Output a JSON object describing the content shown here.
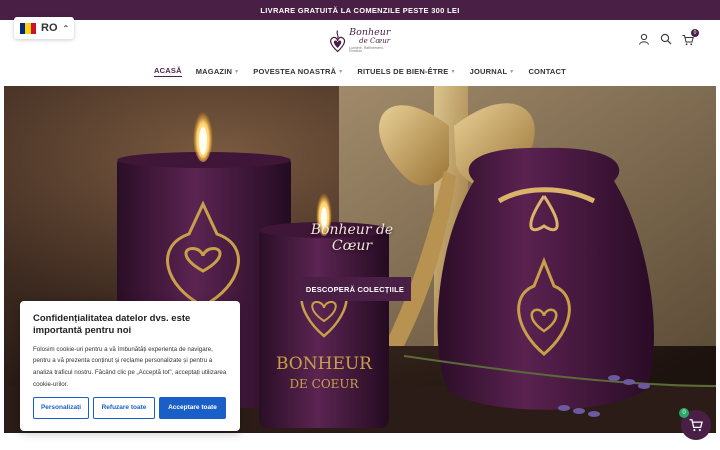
{
  "announcement": "LIVRARE GRATUITĂ LA COMENZILE PESTE 300 LEI",
  "language": {
    "code": "RO",
    "flag_colors": [
      "#002b7f",
      "#fcd116",
      "#ce1126"
    ]
  },
  "logo": {
    "name": "Bonheur",
    "sub": "de Cœur",
    "tagline": "Lumière. Raffinement. Émotion."
  },
  "header_icons": [
    "user-icon",
    "search-icon",
    "cart-icon"
  ],
  "cart_badge": "0",
  "nav": [
    {
      "label": "ACASĂ",
      "active": true,
      "dropdown": false
    },
    {
      "label": "MAGAZIN",
      "active": false,
      "dropdown": true
    },
    {
      "label": "POVESTEA NOASTRĂ",
      "active": false,
      "dropdown": true
    },
    {
      "label": "RITUELS DE BIEN-ÊTRE",
      "active": false,
      "dropdown": true
    },
    {
      "label": "JOURNAL",
      "active": false,
      "dropdown": true
    },
    {
      "label": "CONTACT",
      "active": false,
      "dropdown": false
    }
  ],
  "hero": {
    "title": "Bonheur de Cœur",
    "button": "DESCOPERĂ COLECȚIILE",
    "candle_label_1": "BONHEUR",
    "candle_label_2": "DE COEUR"
  },
  "cookie": {
    "title": "Confidențialitatea datelor dvs. este importantă pentru noi",
    "text": "Folosim cookie-uri pentru a vă îmbunătăți experiența de navigare, pentru a vă prezenta conținut și reclame personalizate și pentru a analiza traficul nostru. Făcând clic pe „Acceptă tot”, acceptați utilizarea cookie-urilor.",
    "buttons": {
      "customize": "Personalizați",
      "reject": "Refuzare toate",
      "accept": "Acceptare toate"
    }
  },
  "floating_cart_count": "0",
  "colors": {
    "brand": "#4a1f45",
    "accent_blue": "#1a5fc8",
    "gold": "#c9a04a",
    "badge_green": "#2aa86b"
  }
}
